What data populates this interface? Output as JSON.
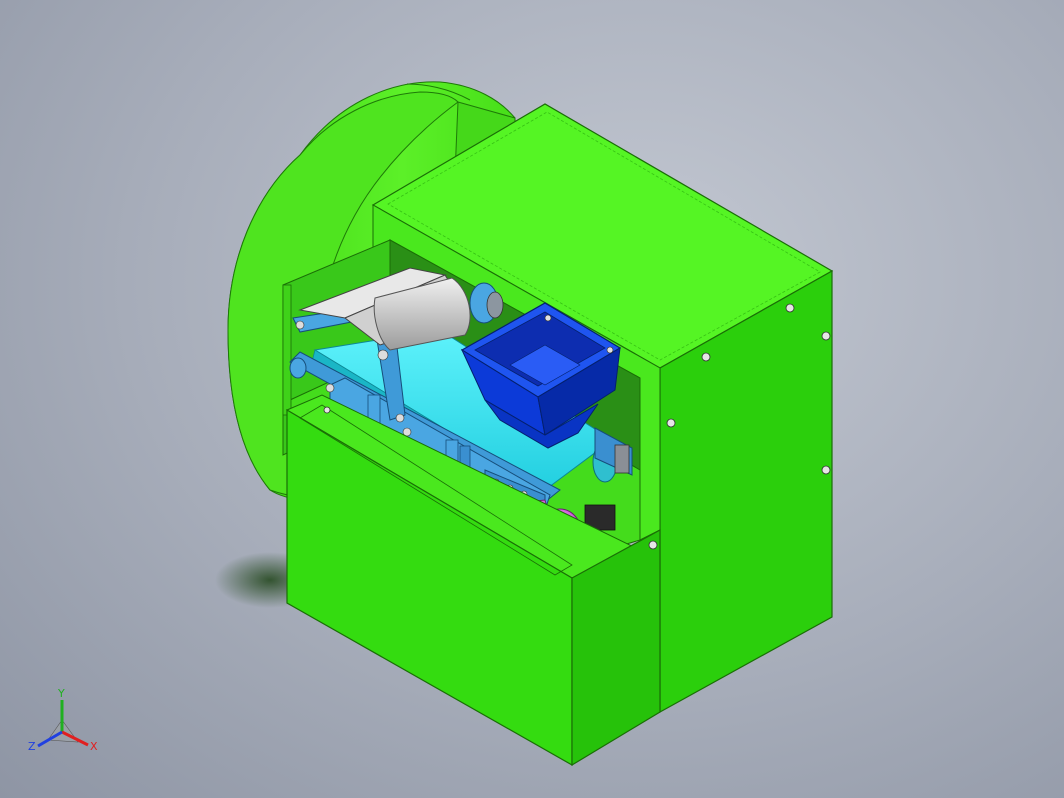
{
  "viewport": {
    "background_top": "#c3c8d2",
    "background_bottom": "#8e95a4"
  },
  "model": {
    "colors": {
      "housing_top": "#52f522",
      "housing_front": "#2fd40f",
      "housing_side": "#25bd0a",
      "drum": "#55ea1c",
      "drum_dark": "#2fc60c",
      "conveyor_belt": "#33e8f5",
      "frame_blue": "#3f9ad8",
      "hopper_blue": "#0c3ad8",
      "hopper_dark": "#062aa8",
      "roller_gray": "#c9c9c9",
      "motor_magenta": "#e46ff0",
      "bolt": "#dcdcdc"
    },
    "parts": [
      "drum-housing",
      "upper-cabinet",
      "lower-cabinet",
      "conveyor-belt",
      "feed-hopper",
      "pressure-roller",
      "drive-motor"
    ]
  },
  "triad": {
    "x_label": "X",
    "y_label": "Y",
    "z_label": "Z",
    "x_color": "#e02020",
    "y_color": "#20b020",
    "z_color": "#2040e0"
  }
}
